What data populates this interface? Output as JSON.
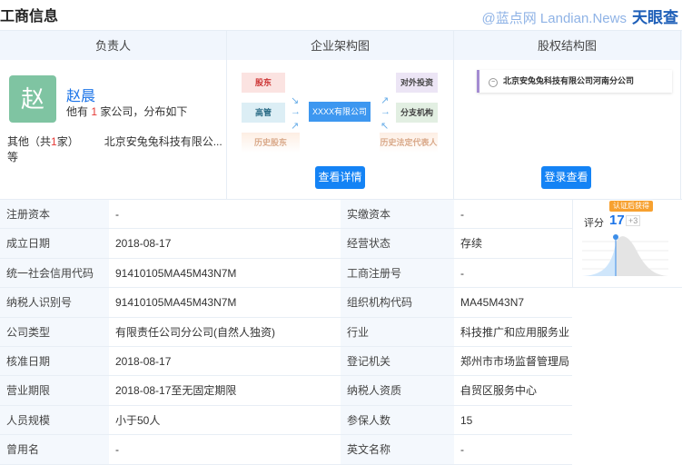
{
  "title": "工商信息",
  "watermark": {
    "site": "@蓝点网 Landian.News",
    "brand": "天眼查"
  },
  "columns": [
    "负责人",
    "企业架构图",
    "股权结构图"
  ],
  "person": {
    "avatar_char": "赵",
    "name": "赵晨",
    "info_pre": "他有 ",
    "count": "1",
    "info_post": " 家公司，分布如下",
    "other_pre": "其他（共",
    "other_count": "1",
    "other_post": "家）",
    "other_company": "北京安兔兔科技有限公...等"
  },
  "structure": {
    "shareholder": "股东",
    "executive": "高管",
    "hist_shareholder": "历史股东",
    "center": "XXXX有限公司",
    "investment": "对外投资",
    "branch": "分支机构",
    "hist_rep": "历史法定代表人",
    "button": "查看详情"
  },
  "equity": {
    "company": "北京安兔兔科技有限公司河南分公司",
    "button": "登录查看",
    "collapse": "−"
  },
  "score": {
    "badge": "认证后获得",
    "label": "评分",
    "value": "17",
    "plus": "+3",
    "max": 100
  },
  "rows": [
    {
      "l1": "注册资本",
      "v1": "-",
      "l2": "实缴资本",
      "v2": "-"
    },
    {
      "l1": "成立日期",
      "v1": "2018-08-17",
      "l2": "经营状态",
      "v2": "存续"
    },
    {
      "l1": "统一社会信用代码",
      "v1": "91410105MA45M43N7M",
      "l2": "工商注册号",
      "v2": "-"
    },
    {
      "l1": "纳税人识别号",
      "v1": "91410105MA45M43N7M",
      "l2": "组织机构代码",
      "v2": "MA45M43N7"
    },
    {
      "l1": "公司类型",
      "v1": "有限责任公司分公司(自然人独资)",
      "l2": "行业",
      "v2": "科技推广和应用服务业"
    },
    {
      "l1": "核准日期",
      "v1": "2018-08-17",
      "l2": "登记机关",
      "v2": "郑州市市场监督管理局自贸区服务中心"
    },
    {
      "l1": "营业期限",
      "v1": "2018-08-17至无固定期限",
      "l2": "纳税人资质",
      "v2": "-"
    },
    {
      "l1": "人员规模",
      "v1": "小于50人",
      "l2": "参保人数",
      "v2": "15"
    },
    {
      "l1": "曾用名",
      "v1": "-",
      "l2": "英文名称",
      "v2": "-"
    }
  ]
}
